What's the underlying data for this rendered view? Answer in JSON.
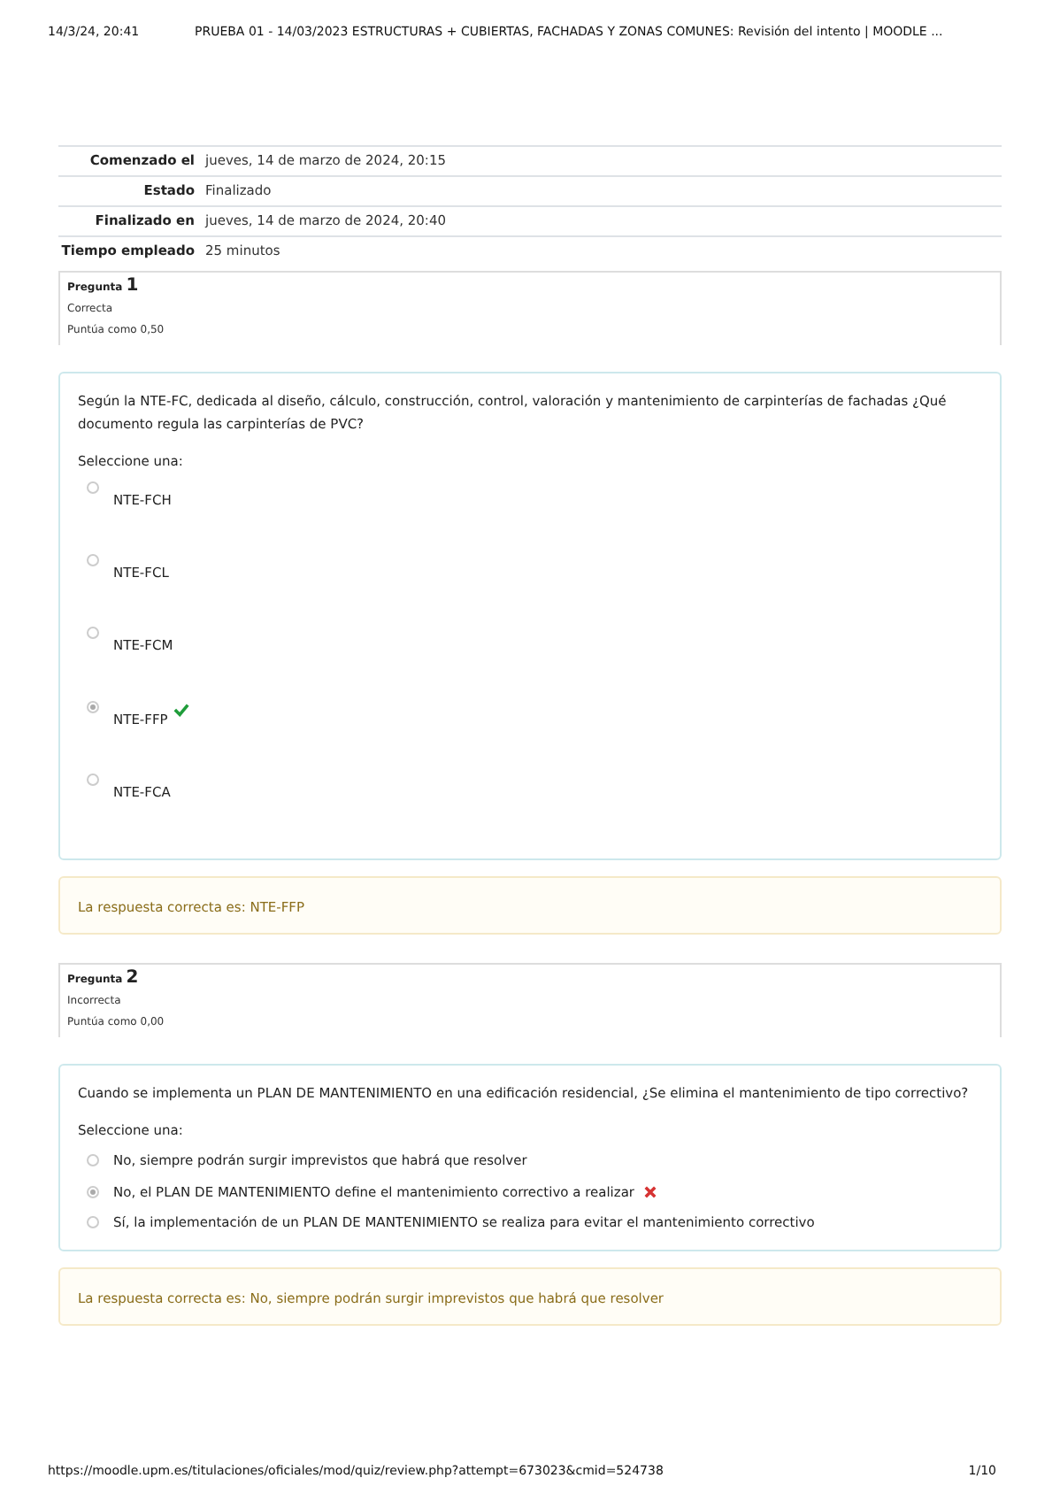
{
  "print_header": {
    "date": "14/3/24, 20:41",
    "title": "PRUEBA 01 - 14/03/2023 ESTRUCTURAS + CUBIERTAS, FACHADAS Y ZONAS COMUNES: Revisión del intento | MOODLE ..."
  },
  "summary": [
    {
      "label": "Comenzado el",
      "value": "jueves, 14 de marzo de 2024, 20:15"
    },
    {
      "label": "Estado",
      "value": "Finalizado"
    },
    {
      "label": "Finalizado en",
      "value": "jueves, 14 de marzo de 2024, 20:40"
    },
    {
      "label": "Tiempo empleado",
      "value": "25 minutos"
    }
  ],
  "questions": [
    {
      "label": "Pregunta",
      "number": "1",
      "status": "Correcta",
      "score": "Puntúa como 0,50",
      "text": "Según la NTE-FC, dedicada al diseño, cálculo, construcción, control, valoración y mantenimiento de carpinterías de fachadas ¿Qué documento regula las carpinterías de PVC?",
      "prompt": "Seleccione una:",
      "kind": "spaced",
      "options": [
        {
          "text": "NTE-FCH",
          "selected": false
        },
        {
          "text": "NTE-FCL",
          "selected": false
        },
        {
          "text": "NTE-FCM",
          "selected": false
        },
        {
          "text": "NTE-FFP",
          "selected": true,
          "kind": "correct"
        },
        {
          "text": "NTE-FCA",
          "selected": false
        }
      ],
      "feedback": "La respuesta correcta es: NTE-FFP"
    },
    {
      "label": "Pregunta",
      "number": "2",
      "status": "Incorrecta",
      "score": "Puntúa como 0,00",
      "text": "Cuando se implementa un PLAN DE MANTENIMIENTO en una edificación residencial, ¿Se elimina el mantenimiento de tipo correctivo?",
      "prompt": "Seleccione una:",
      "kind": "compact",
      "options": [
        {
          "text": "No, siempre podrán surgir imprevistos que habrá que resolver",
          "selected": false
        },
        {
          "text": "No, el PLAN DE MANTENIMIENTO define el mantenimiento correctivo a realizar",
          "selected": true,
          "kind": "incorrect"
        },
        {
          "text": "Sí, la implementación de un PLAN DE MANTENIMIENTO se realiza para evitar el mantenimiento correctivo",
          "selected": false
        }
      ],
      "feedback": "La respuesta correcta es: No, siempre podrán surgir imprevistos que habrá que resolver"
    }
  ],
  "print_footer": {
    "url": "https://moodle.upm.es/titulaciones/oficiales/mod/quiz/review.php?attempt=673023&cmid=524738",
    "page": "1/10"
  }
}
